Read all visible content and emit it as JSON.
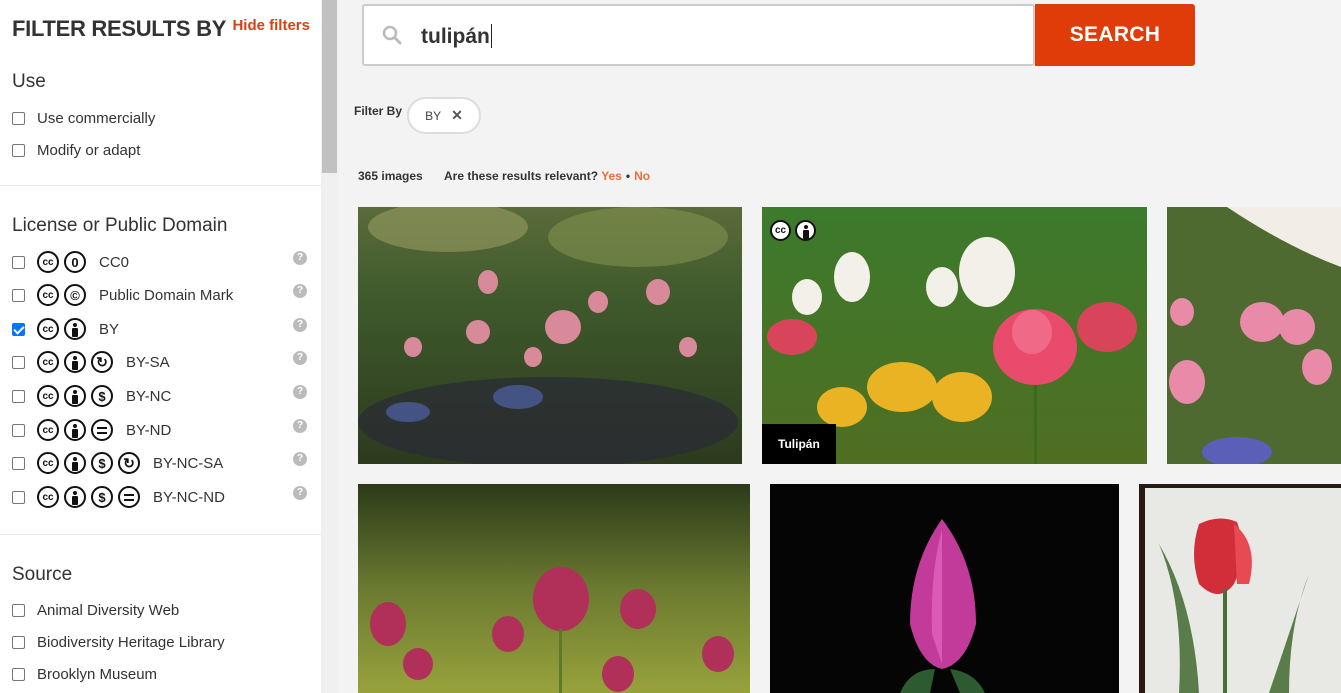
{
  "sidebar": {
    "title": "FILTER RESULTS BY",
    "hide_filters": "Hide filters",
    "use": {
      "title": "Use",
      "options": [
        {
          "label": "Use commercially",
          "checked": false
        },
        {
          "label": "Modify or adapt",
          "checked": false
        }
      ]
    },
    "license": {
      "title": "License or Public Domain",
      "options": [
        {
          "label": "CC0",
          "checked": false
        },
        {
          "label": "Public Domain Mark",
          "checked": false
        },
        {
          "label": "BY",
          "checked": true
        },
        {
          "label": "BY-SA",
          "checked": false
        },
        {
          "label": "BY-NC",
          "checked": false
        },
        {
          "label": "BY-ND",
          "checked": false
        },
        {
          "label": "BY-NC-SA",
          "checked": false
        },
        {
          "label": "BY-NC-ND",
          "checked": false
        }
      ]
    },
    "source": {
      "title": "Source",
      "options": [
        {
          "label": "Animal Diversity Web",
          "checked": false
        },
        {
          "label": "Biodiversity Heritage Library",
          "checked": false
        },
        {
          "label": "Brooklyn Museum",
          "checked": false
        }
      ]
    }
  },
  "search": {
    "query": "tulipán",
    "button_label": "SEARCH"
  },
  "filters": {
    "label": "Filter By",
    "chip": "BY",
    "chip_remove": "✕"
  },
  "results": {
    "count": "365 images",
    "relevance_question": "Are these results relevant?",
    "yes": "Yes",
    "dot": "•",
    "no": "No"
  },
  "cards": {
    "card2_title": "Tulipán"
  },
  "icons": {
    "help": "?",
    "cc": "cc",
    "zero": "0",
    "nc": "$",
    "sa": "↻"
  },
  "colors": {
    "accent": "#e03c0a",
    "link": "#d44314",
    "checkbox": "#0075ff"
  }
}
